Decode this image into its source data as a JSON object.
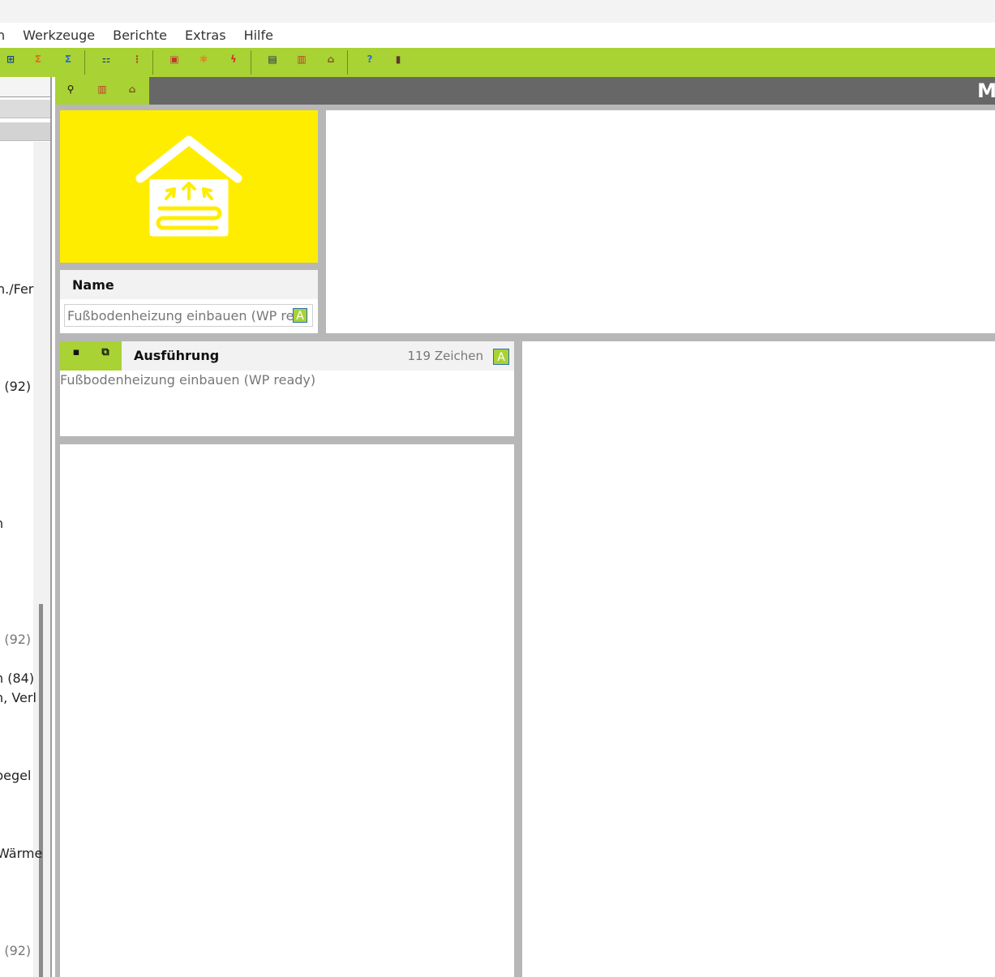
{
  "menu": {
    "items": [
      "n",
      "Werkzeuge",
      "Berichte",
      "Extras",
      "Hilfe"
    ]
  },
  "toolbar": {
    "icons": [
      {
        "name": "tree-structure-icon",
        "glyph": "⊞",
        "color": "#1a4a8a"
      },
      {
        "name": "sum-orange-icon",
        "glyph": "Σ",
        "color": "#e0701a"
      },
      {
        "name": "sum-blue-icon",
        "glyph": "Σ",
        "color": "#2b6fc2"
      },
      {
        "name": "hierarchy-icon",
        "glyph": "⚏",
        "color": "#1a3a6a"
      },
      {
        "name": "list-tree-icon",
        "glyph": "⋮",
        "color": "#b04a2a"
      },
      {
        "name": "document-red-icon",
        "glyph": "▣",
        "color": "#c0392b"
      },
      {
        "name": "sun-icon",
        "glyph": "✱",
        "color": "#e08a2a"
      },
      {
        "name": "lightning-icon",
        "glyph": "ϟ",
        "color": "#d0302a"
      },
      {
        "name": "report-icon",
        "glyph": "▤",
        "color": "#1a2a4a"
      },
      {
        "name": "pdf-icon",
        "glyph": "▥",
        "color": "#c0392b"
      },
      {
        "name": "house-outline-icon",
        "glyph": "⌂",
        "color": "#7a5a1a"
      },
      {
        "name": "help-icon",
        "glyph": "?",
        "color": "#2b6fc2"
      },
      {
        "name": "exit-icon",
        "glyph": "▮",
        "color": "#5a3a2a"
      }
    ]
  },
  "left_panel": {
    "items": [
      {
        "text": "n./Fer",
        "gray": false
      },
      {
        "text": ") (92)",
        "gray": false
      },
      {
        "text": "n",
        "gray": false
      },
      {
        "text": ") (92)",
        "gray": true
      },
      {
        "text": "n (84)",
        "gray": false
      },
      {
        "text": "n, Verl",
        "gray": false
      },
      {
        "text": " begel",
        "gray": false
      },
      {
        "text": "Wärme",
        "gray": false
      },
      {
        "text": ") (92)",
        "gray": true
      }
    ]
  },
  "main": {
    "header_text": "M",
    "toolbar_icons": [
      {
        "name": "zoom-add-icon",
        "glyph": "⚲",
        "color": "#111"
      },
      {
        "name": "pdf-export-icon",
        "glyph": "▥",
        "color": "#c0392b"
      },
      {
        "name": "house-outline-icon",
        "glyph": "⌂",
        "color": "#7a5a1a"
      }
    ],
    "image": {
      "icon": "underfloor-heating-house-icon",
      "background": "#ffed00"
    },
    "name_section": {
      "label": "Name",
      "value": "Fußbodenheizung einbauen (WP ready)",
      "badge": "A"
    },
    "execution": {
      "title": "Ausführung",
      "char_count": "119 Zeichen",
      "badge": "A",
      "text": "Fußbodenheizung einbauen (WP ready)",
      "save_icon": "save-icon",
      "copy_icon": "copy-icon"
    }
  },
  "colors": {
    "accent_green": "#a9d234",
    "header_gray": "#676767",
    "yellow": "#ffed00"
  }
}
